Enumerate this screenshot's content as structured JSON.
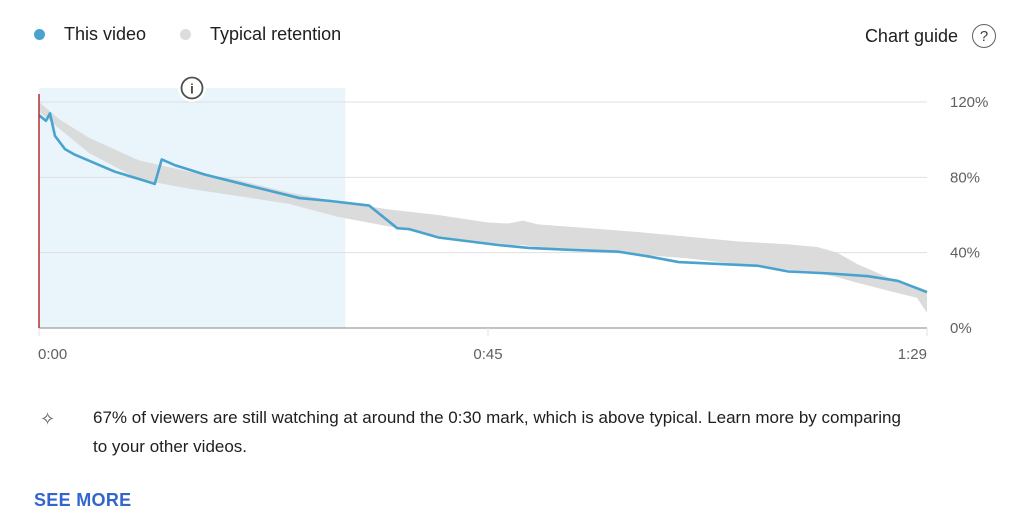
{
  "legend": {
    "items": [
      {
        "label": "This video",
        "color": "#4aa3cf"
      },
      {
        "label": "Typical retention",
        "color": "#dcdcdc"
      }
    ]
  },
  "chart_guide": {
    "label": "Chart guide",
    "icon": "help-circle-icon",
    "glyph": "?"
  },
  "info_marker": {
    "icon": "info-icon",
    "glyph": "i"
  },
  "colors": {
    "this_video": "#4aa3cf",
    "typical_band": "#d9d9d9",
    "highlight_region": "#eaf4fb",
    "start_marker": "#b03030",
    "gridline": "#e0e0e0",
    "axis": "#9e9e9e",
    "link": "#3366cc"
  },
  "chart_data": {
    "type": "line",
    "title": "",
    "xlabel": "",
    "ylabel": "",
    "x_unit": "seconds",
    "xlim": [
      0,
      89
    ],
    "ylim": [
      0,
      120
    ],
    "x_ticks": [
      {
        "value": 0,
        "label": "0:00"
      },
      {
        "value": 45,
        "label": "0:45"
      },
      {
        "value": 89,
        "label": "1:29"
      }
    ],
    "y_ticks": [
      {
        "value": 0,
        "label": "0%"
      },
      {
        "value": 40,
        "label": "40%"
      },
      {
        "value": 80,
        "label": "80%"
      },
      {
        "value": 120,
        "label": "120%"
      }
    ],
    "grid": true,
    "legend_position": "top-left",
    "highlight_region": {
      "x_start": 0,
      "x_end": 30.7
    },
    "series": [
      {
        "name": "This video",
        "x": [
          0,
          0.7,
          1.1,
          1.6,
          2.6,
          3.6,
          5.6,
          7.6,
          10.1,
          11.6,
          12.3,
          13.6,
          16.6,
          21.1,
          26.1,
          29.1,
          33.1,
          35.9,
          37.1,
          40.1,
          43.1,
          46.1,
          49.1,
          53.1,
          58.1,
          61.1,
          64.1,
          68.1,
          72.1,
          75.1,
          79.1,
          83.1,
          86.1,
          89
        ],
        "values": [
          113,
          110,
          114,
          102,
          95,
          92,
          87.5,
          83,
          79,
          76.5,
          89.5,
          86.5,
          81.5,
          75.5,
          69,
          67.5,
          65,
          53,
          52.5,
          48,
          46,
          44,
          42.5,
          41.5,
          40.5,
          38,
          35,
          34,
          33,
          30,
          29,
          27.5,
          25,
          19
        ]
      },
      {
        "name": "Typical retention",
        "type": "band",
        "x": [
          0,
          2,
          5,
          10,
          15,
          20,
          25,
          30,
          35,
          40,
          45,
          47,
          48.5,
          50,
          55,
          60,
          65,
          70,
          75,
          78,
          80,
          82,
          85,
          88,
          89
        ],
        "upper": [
          120,
          111,
          101,
          89,
          83,
          78.5,
          72,
          67,
          63,
          60,
          56,
          55.5,
          57,
          55,
          53,
          51,
          48.5,
          46,
          44.5,
          43,
          40,
          34,
          27,
          22,
          20
        ],
        "lower": [
          115,
          106,
          93,
          79,
          74,
          70,
          66,
          59,
          54,
          49,
          45,
          44,
          44,
          43,
          41,
          39,
          37,
          34,
          31,
          29,
          27,
          24,
          20,
          16,
          8
        ]
      }
    ]
  },
  "insight": {
    "icon": "sparkle-icon",
    "glyph": "✧",
    "text": "67% of viewers are still watching at around the 0:30 mark, which is above typical. Learn more by comparing to your other videos."
  },
  "see_more": {
    "label": "SEE MORE"
  }
}
